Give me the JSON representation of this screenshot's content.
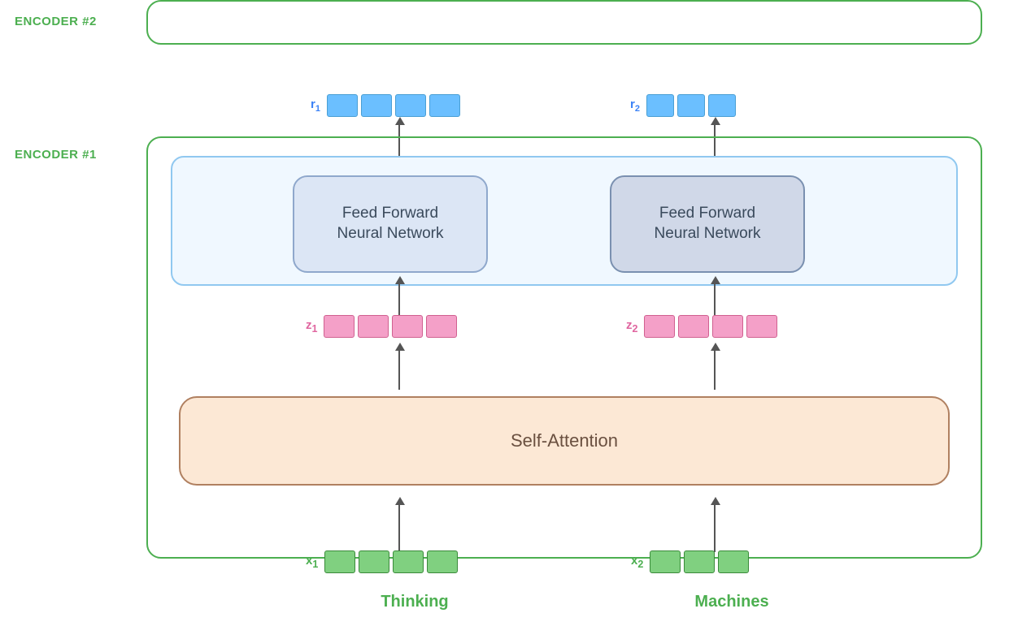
{
  "labels": {
    "encoder2": "ENCODER #2",
    "encoder1": "ENCODER #1",
    "ffnn_left": "Feed Forward\nNeural Network",
    "ffnn_right": "Feed Forward\nNeural Network",
    "self_attention": "Self-Attention",
    "r1": "r",
    "r1_sub": "1",
    "r2": "r",
    "r2_sub": "2",
    "z1": "z",
    "z1_sub": "1",
    "z2": "z",
    "z2_sub": "2",
    "x1": "x",
    "x1_sub": "1",
    "x2": "x",
    "x2_sub": "2",
    "word1": "Thinking",
    "word2": "Machines"
  },
  "colors": {
    "green": "#4caf50",
    "blue": "#6bbfff",
    "pink": "#f4a0c8",
    "orange_bg": "#fce8d5",
    "light_blue_bg": "#f0f8ff",
    "ffnn_left_bg": "#dce6f5",
    "ffnn_right_bg": "#d0d8e8",
    "text_dark": "#3a4a5c",
    "pink_label": "#e066a0",
    "blue_label": "#3b82f6"
  }
}
